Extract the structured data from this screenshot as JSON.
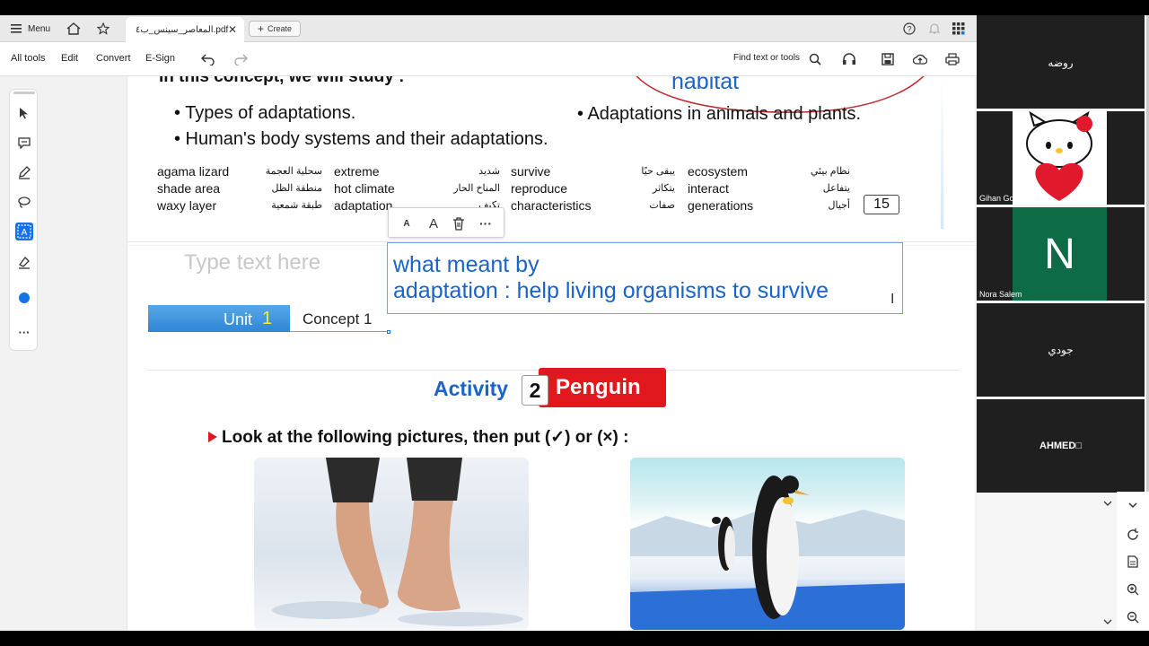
{
  "tabbar": {
    "menu_label": "Menu",
    "tab_title": "المعاصر_سينس_ب٤.pdf",
    "create_label": "Create"
  },
  "toolbar": {
    "all_tools": "All tools",
    "edit": "Edit",
    "convert": "Convert",
    "esign": "E-Sign",
    "find_text": "Find text or tools"
  },
  "document": {
    "partial_heading": "In this concept, we will study :",
    "bullets_left": [
      "• Types of adaptations.",
      "• Human's body systems and their adaptations."
    ],
    "bullet_right": "• Adaptations in animals and plants.",
    "circled_word": "habitat",
    "vocab_columns": [
      {
        "en": [
          "agama lizard",
          "shade area",
          "waxy layer"
        ],
        "ar": [
          "سحلية العجمة",
          "منطقة الظل",
          "طبقة شمعية"
        ]
      },
      {
        "en": [
          "extreme",
          "hot climate",
          "adaptation"
        ],
        "ar": [
          "شديد",
          "المناخ الحار",
          "تكيف"
        ]
      },
      {
        "en": [
          "survive",
          "reproduce",
          "characteristics"
        ],
        "ar": [
          "يبقى حيًا",
          "يتكاثر",
          "صفات"
        ]
      },
      {
        "en": [
          "ecosystem",
          "interact",
          "generations"
        ],
        "ar": [
          "نظام بيئي",
          "يتفاعل",
          "أجيال"
        ]
      }
    ],
    "page_number": "15",
    "placeholder_text": "Type text here",
    "textbox_line1": "what meant by",
    "textbox_line2": "adaptation : help living organisms to survive",
    "unit_label": "Unit",
    "unit_number": "1",
    "concept_label": "Concept 1",
    "activity_label": "Activity",
    "activity_number": "2",
    "activity_title": "Penguin",
    "instruction": "Look at the following pictures, then put (✓) or (×) :"
  },
  "participants": [
    {
      "name": "روضه",
      "label": ""
    },
    {
      "name": "",
      "label": "Gihan Gomaa"
    },
    {
      "name": "N",
      "label": "Nora Salem"
    },
    {
      "name": "جودي",
      "label": ""
    },
    {
      "name": "AHMED□",
      "label": ""
    }
  ],
  "colors": {
    "accent_blue": "#1473e6",
    "activity_red": "#e2181f",
    "nora_tile_green": "#0d6b45"
  }
}
